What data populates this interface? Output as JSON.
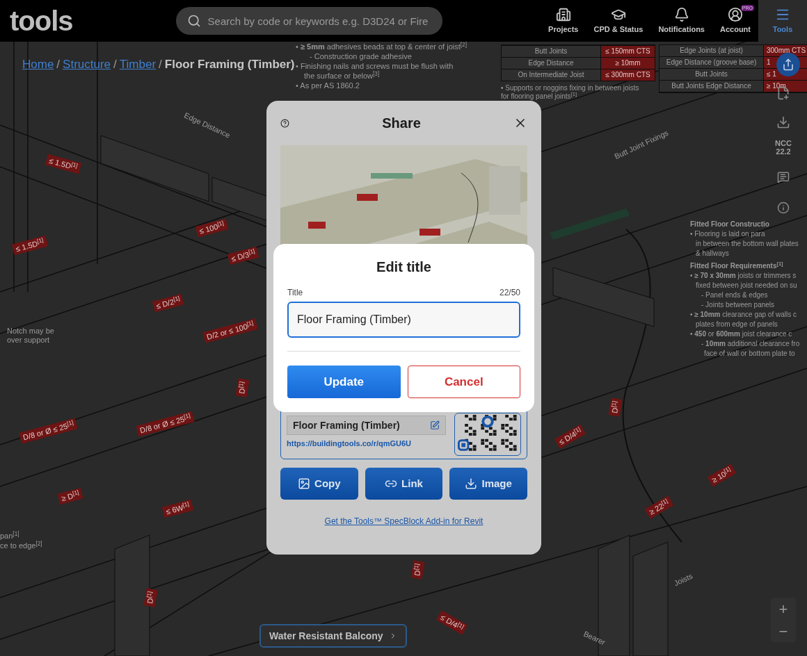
{
  "top_bar": {
    "logo": "tools",
    "search": {
      "placeholder": "Search by code or keywords e.g. D3D24 or Fire"
    },
    "nav": [
      {
        "label": "Projects",
        "selected": false
      },
      {
        "label": "CPD & Status",
        "selected": false
      },
      {
        "label": "Notifications",
        "selected": false
      },
      {
        "label": "Account",
        "badge": "PRO",
        "selected": false
      },
      {
        "label": "Tools",
        "selected": true
      }
    ]
  },
  "breadcrumb": [
    {
      "label": "Home",
      "kind": "link"
    },
    {
      "label": "/",
      "kind": "separator"
    },
    {
      "label": "Structure",
      "kind": "link"
    },
    {
      "label": "/",
      "kind": "separator"
    },
    {
      "label": "Timber",
      "kind": "link"
    },
    {
      "label": "/",
      "kind": "separator"
    },
    {
      "label": "Floor Framing (Timber)",
      "kind": "current"
    }
  ],
  "notes_top": [
    {
      "kind": "bullet",
      "text": "• **≥ 5mm** adhesives beads at top & center of joist$^{[2]}$"
    },
    {
      "kind": "sub",
      "text": "- Construction grade adhesive"
    },
    {
      "kind": "bullet",
      "text": "• Finishing nails and screws must be flush with"
    },
    {
      "kind": "cont",
      "text": "the surface or below$^{[3]}$"
    },
    {
      "kind": "bullet",
      "text": "• As per AS 1860.2"
    }
  ],
  "table_left": {
    "rows": [
      {
        "label": "Butt Joints",
        "value": "≤ 150mm CTS"
      },
      {
        "label": "Edge Distance",
        "value": "≥ 10mm"
      },
      {
        "label": "On Intermediate Joist",
        "value": "≤ 300mm CTS"
      }
    ],
    "note": "• Supports or noggins fixing in between joists for flooring panel joints$^{[1]}$"
  },
  "table_right": {
    "rows": [
      {
        "label": "Edge Joints (at joist)",
        "value": "300mm CTS"
      },
      {
        "label": "Edge Distance (groove base)",
        "value": "1"
      },
      {
        "label": "Butt Joints",
        "value": "≤ 1"
      },
      {
        "label": "Butt Joints Edge Distance",
        "value": "≥ 10m"
      }
    ]
  },
  "notes_right": [
    {
      "kind": "heading",
      "text": "Fitted Floor Constructio"
    },
    {
      "kind": "bullet",
      "text": "• Flooring is laid on para"
    },
    {
      "kind": "cont",
      "text": "in between the bottom wall plates"
    },
    {
      "kind": "cont",
      "text": "& hallways"
    },
    {
      "kind": "heading",
      "text": "Fitted Floor Requirements$^{[1]}$"
    },
    {
      "kind": "bullet",
      "text": "• **≥ 70 x 30mm** joists or trimmers s"
    },
    {
      "kind": "cont",
      "text": "fixed between joist needed on su"
    },
    {
      "kind": "sub",
      "text": "- Panel ends & edges"
    },
    {
      "kind": "sub",
      "text": "- Joints between panels"
    },
    {
      "kind": "bullet",
      "text": "• **≥ 10mm** clearance gap of walls c"
    },
    {
      "kind": "cont",
      "text": "plates from edge of panels"
    },
    {
      "kind": "bullet",
      "text": "• **450** or **600mm** joist clearance c"
    },
    {
      "kind": "sub",
      "text": "- **10mm** additional clearance fro"
    },
    {
      "kind": "cont2",
      "text": "face of wall or bottom plate to"
    }
  ],
  "left_notes": [
    "pan$^{[1]}$",
    "ce to edge$^{[2]}$"
  ],
  "drawing": {
    "dimension_tags": [
      "≤ 1.5D$^{[1]}$",
      "≤ 1.5D$^{[1]}$",
      "≤ 100$^{[1]}$",
      "≤ D/3$^{[1]}$",
      "≤ D/2$^{[1]}$",
      "D/2 or ≤ 100$^{[1]}$",
      "D$^{[1]}$",
      "D/8 or Ø ≤ 25$^{[1]}$",
      "D/8 or Ø ≤ 25$^{[1]}$",
      "≥ D$^{[1]}$",
      "≤ 6W$^{[1]}$",
      "D$^{[1]}$",
      "D$^{[1]}$",
      "≤ D/4$^{[1]}$",
      "D$^{[1]}$",
      "≤ D/4$^{[1]}$",
      "≥ 10$^{[1]}$",
      "≥ 22$^{[1]}$"
    ],
    "captions": [
      "Edge Distance",
      "Butt Joint Fixings",
      "Notch may be over support",
      "Joists",
      "Bearer"
    ]
  },
  "side_toolbar": {
    "version_label": "NCC 22.2"
  },
  "zoom_controls": {
    "zoom_in": "+",
    "zoom_out": "−"
  },
  "next_page": {
    "label": "Water Resistant Balcony"
  },
  "share_dialog": {
    "title": "Share",
    "share_title": "Floor Framing (Timber)",
    "url": "https://buildingtools.co/r/qmGU6U",
    "buttons": [
      "Copy",
      "Link",
      "Image"
    ],
    "addin_link": "Get the Tools™ SpecBlock Add-in for Revit"
  },
  "edit_title_dialog": {
    "title": "Edit title",
    "field_label": "Title",
    "counter": "22/50",
    "value": "Floor Framing (Timber)",
    "buttons": [
      {
        "label": "Update",
        "kind": "primary"
      },
      {
        "label": "Cancel",
        "kind": "secondary"
      }
    ]
  }
}
